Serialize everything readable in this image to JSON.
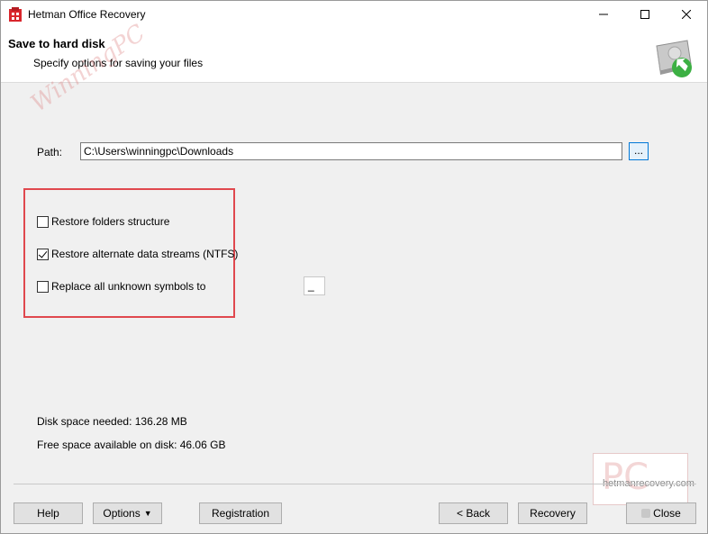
{
  "window": {
    "title": "Hetman Office Recovery"
  },
  "header": {
    "title": "Save to hard disk",
    "subtitle": "Specify options for saving your files",
    "watermark": "WinningPC"
  },
  "form": {
    "path_label": "Path:",
    "path_value": "C:\\Users\\winningpc\\Downloads",
    "browse_label": "...",
    "options": [
      {
        "label": "Restore folders structure",
        "checked": false
      },
      {
        "label": "Restore alternate data streams (NTFS)",
        "checked": true
      },
      {
        "label": "Replace all unknown symbols to",
        "checked": false
      }
    ],
    "replace_symbol": "_"
  },
  "info": {
    "disk_space_needed": "Disk space needed: 136.28 MB",
    "free_space": "Free space available on disk: 46.06 GB"
  },
  "branding": {
    "logo_letters": "PC",
    "site": "hetmanrecovery.com"
  },
  "buttons": {
    "help": "Help",
    "options": "Options",
    "registration": "Registration",
    "back": "< Back",
    "recovery": "Recovery",
    "close": "Close"
  },
  "colors": {
    "highlight": "#e0484e",
    "accent": "#0078d7",
    "app_icon": "#d9262c"
  }
}
